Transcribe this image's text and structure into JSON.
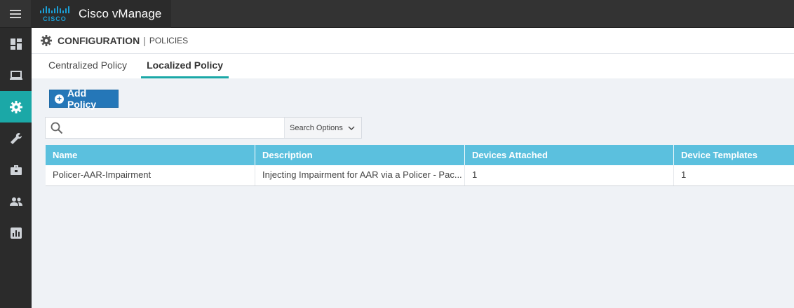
{
  "app": {
    "brand_title": "Cisco vManage",
    "logo_text": "CISCO"
  },
  "header": {
    "title": "CONFIGURATION",
    "separator": "|",
    "subtitle": "POLICIES"
  },
  "tabs": [
    {
      "label": "Centralized Policy",
      "active": false
    },
    {
      "label": "Localized Policy",
      "active": true
    }
  ],
  "sidebar": {
    "items": [
      {
        "icon": "dashboard-icon"
      },
      {
        "icon": "monitor-icon"
      },
      {
        "icon": "gear-icon",
        "active": true
      },
      {
        "icon": "wrench-icon"
      },
      {
        "icon": "toolbox-icon"
      },
      {
        "icon": "users-icon"
      },
      {
        "icon": "report-icon"
      }
    ]
  },
  "toolbar": {
    "add_label": "Add Policy"
  },
  "search": {
    "value": "",
    "placeholder": "",
    "options_label": "Search Options"
  },
  "table": {
    "columns": [
      "Name",
      "Description",
      "Devices Attached",
      "Device Templates"
    ],
    "rows": [
      [
        "Policer-AAR-Impairment",
        "Injecting Impairment for AAR via a Policer - Pac...",
        "1",
        "1"
      ]
    ]
  },
  "colors": {
    "accent": "#1ba8a7",
    "primary_button": "#2577b8",
    "table_header": "#5bc0de",
    "topbar": "#333333"
  }
}
